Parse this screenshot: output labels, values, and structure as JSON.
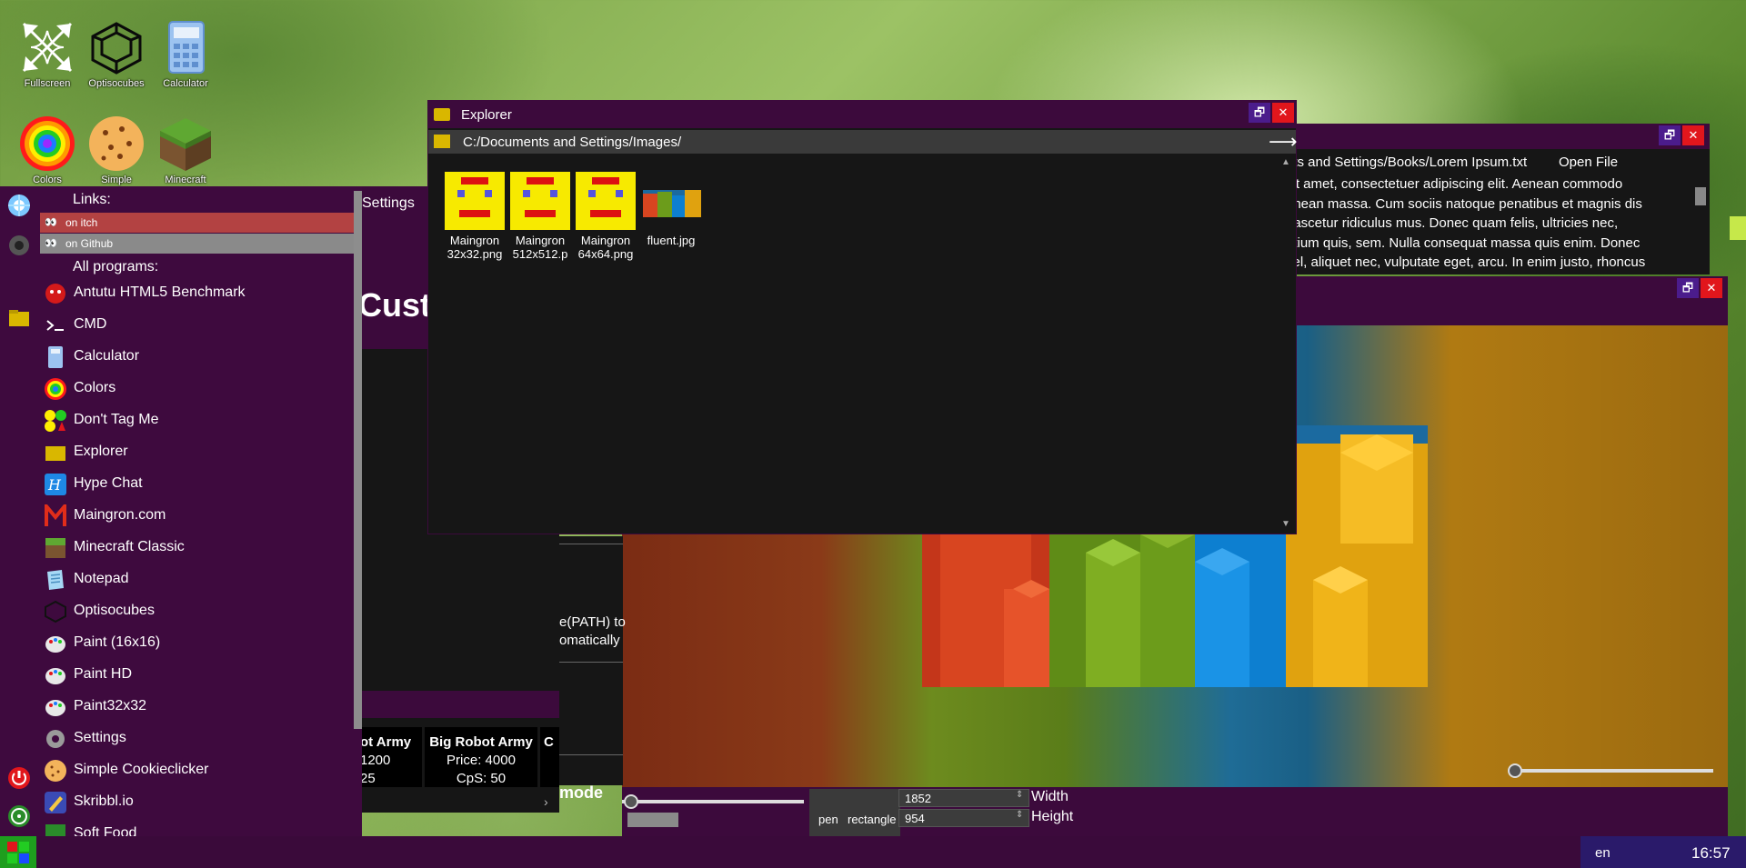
{
  "desktop": {
    "icons": [
      {
        "label": "Fullscreen"
      },
      {
        "label": "Optisocubes"
      },
      {
        "label": "Calculator"
      },
      {
        "label": "Colors"
      },
      {
        "label": "Simple"
      },
      {
        "label": "Minecraft"
      }
    ]
  },
  "explorer": {
    "title": "Explorer",
    "path": "C:/Documents and Settings/Images/",
    "files": [
      {
        "line1": "Maingron",
        "line2": "32x32.png"
      },
      {
        "line1": "Maingron",
        "line2": "512x512.p"
      },
      {
        "line1": "Maingron",
        "line2": "64x64.png"
      },
      {
        "line1": "fluent.jpg",
        "line2": ""
      }
    ]
  },
  "textviewer": {
    "path_fragment": "nts and Settings/Books/Lorem Ipsum.txt",
    "open_file": "Open File",
    "lines": [
      "sit amet, consectetuer adipiscing elit. Aenean commodo",
      "enean massa. Cum sociis natoque penatibus et magnis dis",
      "nascetur ridiculus mus. Donec quam felis, ultricies nec,",
      "etium quis, sem. Nulla consequat massa quis enim. Donec",
      "vel, aliquet nec, vulputate eget, arcu. In enim justo, rhoncus"
    ]
  },
  "settings_fragment": {
    "label": "Settings",
    "heading": "Custo"
  },
  "cookie_fragment": {
    "path_text_1": "e(PATH) to",
    "path_text_2": "omatically",
    "card1": {
      "name": "ot Army",
      "price": "1200",
      "cps": "25"
    },
    "card2": {
      "name": "Big Robot Army",
      "price": "Price: 4000",
      "cps": "CpS: 50"
    },
    "card3": {
      "name": "C"
    },
    "mode": "mode",
    "arrow": "›"
  },
  "paint": {
    "tools": {
      "pen": "pen",
      "rectangle": "rectangle"
    },
    "width_value": "1852",
    "height_value": "954",
    "width_label": "Width",
    "height_label": "Height"
  },
  "start_menu": {
    "links_heading": "Links:",
    "links": [
      {
        "label": "on itch"
      },
      {
        "label": "on Github"
      }
    ],
    "all_programs_heading": "All programs:",
    "programs": [
      {
        "label": "Antutu HTML5 Benchmark"
      },
      {
        "label": "CMD"
      },
      {
        "label": "Calculator"
      },
      {
        "label": "Colors"
      },
      {
        "label": "Don't Tag Me"
      },
      {
        "label": "Explorer"
      },
      {
        "label": "Hype Chat"
      },
      {
        "label": "Maingron.com"
      },
      {
        "label": "Minecraft Classic"
      },
      {
        "label": "Notepad"
      },
      {
        "label": "Optisocubes"
      },
      {
        "label": "Paint (16x16)"
      },
      {
        "label": "Paint HD"
      },
      {
        "label": "Paint32x32"
      },
      {
        "label": "Settings"
      },
      {
        "label": "Simple Cookieclicker"
      },
      {
        "label": "Skribbl.io"
      },
      {
        "label": "Soft Food"
      }
    ]
  },
  "taskbar": {
    "language": "en",
    "clock": "16:57"
  }
}
